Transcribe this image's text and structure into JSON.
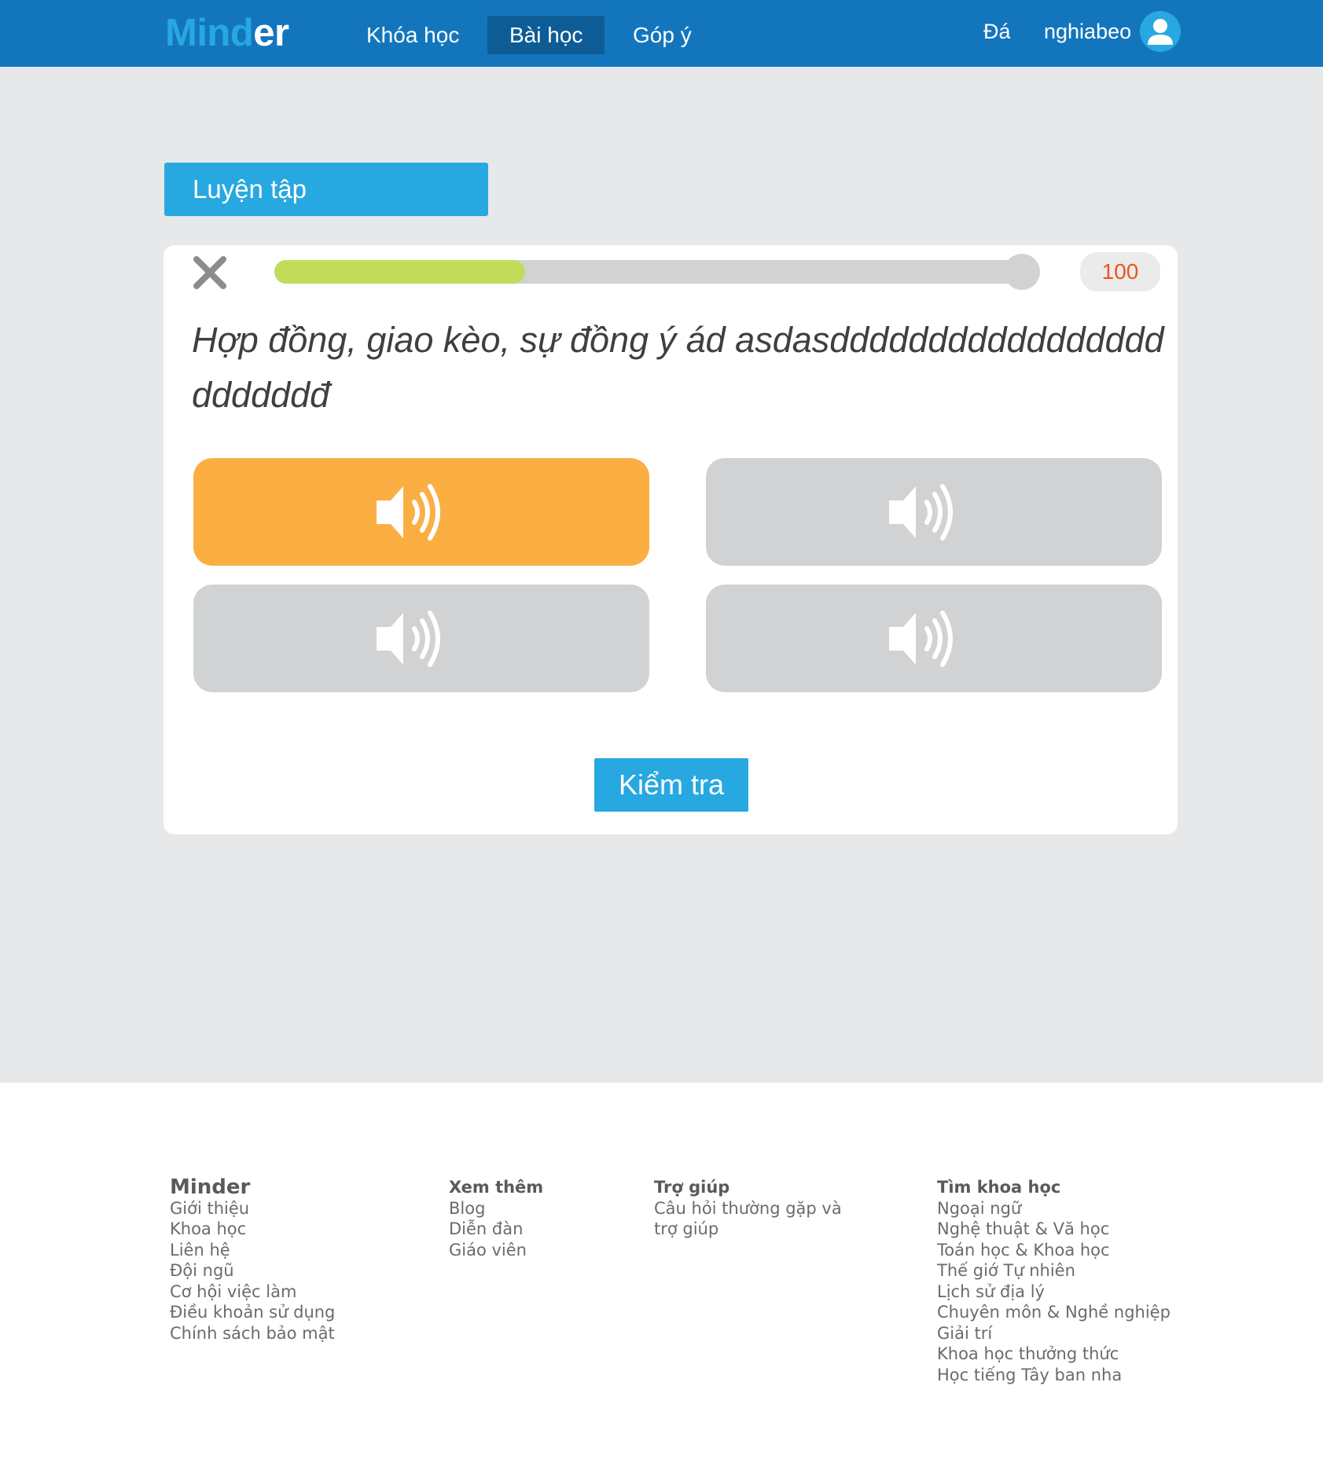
{
  "header": {
    "logo_part1": "Mind",
    "logo_part2": "er",
    "nav": [
      {
        "label": "Khóa học"
      },
      {
        "label": "Bài học"
      },
      {
        "label": "Góp ý"
      }
    ],
    "language": "Đá",
    "username": "nghiabeo",
    "colors": {
      "background": "#1376bd",
      "active_tab": "#0e5c96",
      "accent": "#27a8e0"
    }
  },
  "practice": {
    "title": "Luyện tập",
    "progress": 0.33,
    "score": "100",
    "question": "Hợp đồng, giao kèo, sự đồng ý ád asdasdddddddddddddddddddddddđ",
    "options": [
      {
        "icon": "speaker-icon",
        "selected": true
      },
      {
        "icon": "speaker-icon",
        "selected": false
      },
      {
        "icon": "speaker-icon",
        "selected": false
      },
      {
        "icon": "speaker-icon",
        "selected": false
      }
    ],
    "check_label": "Kiểm tra",
    "colors": {
      "selected_option": "#fbaf43",
      "option": "#d1d2d4",
      "progress": "#c2dc5a",
      "score_text": "#e8571f"
    }
  },
  "footer": {
    "columns": [
      {
        "heading": "Minder",
        "links": [
          "Giới thiệu",
          "Khoa học",
          "Liên hệ",
          "Đội ngũ",
          "Cơ hội việc làm",
          "Điều khoản sử dụng",
          "Chính sách bảo mật"
        ]
      },
      {
        "heading": "Xem thêm",
        "links": [
          "Blog",
          "Diễn đàn",
          "Giáo viên"
        ]
      },
      {
        "heading": "Trợ giúp",
        "links": [
          "Câu hỏi thường gặp và trợ giúp"
        ]
      },
      {
        "heading": "Tìm khoa học",
        "links": [
          "Ngoại ngữ",
          "Nghệ thuật & Vă học",
          "Toán học & Khoa học",
          "Thế giớ Tự nhiên",
          "Lịch sử địa lý",
          "Chuyên môn & Nghề nghiệp",
          "Giải trí",
          "Khoa học thưởng thức",
          "Học tiếng Tây ban nha"
        ]
      }
    ]
  }
}
